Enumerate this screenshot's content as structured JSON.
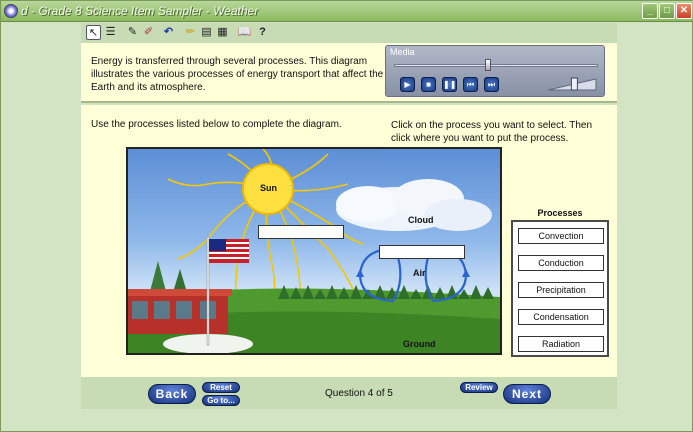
{
  "window": {
    "title": "d - Grade 8 Science Item Sampler - Weather",
    "minimize_icon": "minimize-icon",
    "maximize_icon": "maximize-icon",
    "close_icon": "close-icon"
  },
  "toolbar": {
    "tools": [
      "pointer-icon",
      "list-icon",
      "pen-icon",
      "eraser-icon",
      "undo-icon",
      "highlighter-icon",
      "notepad-icon",
      "calculator-icon",
      "book-icon",
      "help-icon"
    ],
    "help_label": "?"
  },
  "intro": {
    "text": "Energy is transferred through several processes. This diagram illustrates the various processes of energy transport that affect the Earth and its atmosphere."
  },
  "media": {
    "title": "Media",
    "progress": 0.46,
    "volume": 0.55,
    "buttons": [
      "play-icon",
      "stop-icon",
      "pause-icon",
      "rewind-icon",
      "forward-icon"
    ]
  },
  "instructions": {
    "left": "Use the processes listed below to complete the diagram.",
    "right": "Click on the process you want to select. Then click where you want to put the process."
  },
  "diagram": {
    "sun_label": "Sun",
    "cloud_label": "Cloud",
    "air_label": "Air",
    "ground_label": "Ground"
  },
  "processes": {
    "title": "Processes",
    "items": [
      "Convection",
      "Conduction",
      "Precipitation",
      "Condensation",
      "Radiation"
    ]
  },
  "nav": {
    "back": "Back",
    "reset": "Reset",
    "goto": "Go to...",
    "question": "Question 4 of 5",
    "review": "Review",
    "next": "Next"
  }
}
